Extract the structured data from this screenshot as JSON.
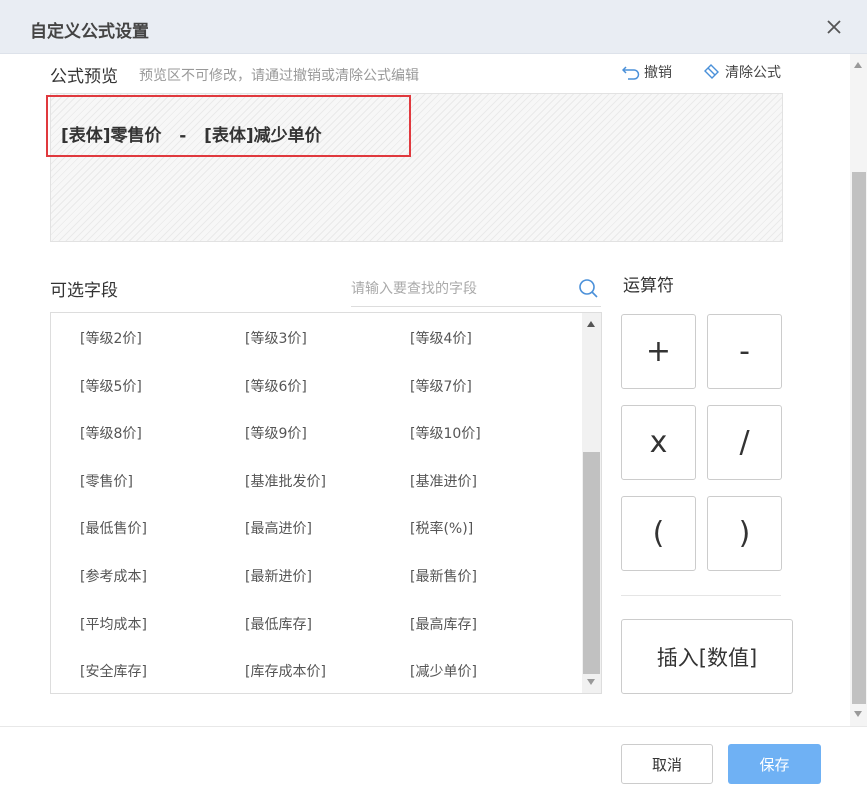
{
  "dialog": {
    "title": "自定义公式设置"
  },
  "preview": {
    "label": "公式预览",
    "hint": "预览区不可修改，请通过撤销或清除公式编辑",
    "undo_label": "撤销",
    "clear_label": "清除公式",
    "formula": "[表体]零售价   -   [表体]减少单价"
  },
  "fields": {
    "label": "可选字段",
    "search_placeholder": "请输入要查找的字段",
    "rows": [
      [
        "[等级2价]",
        "[等级3价]",
        "[等级4价]"
      ],
      [
        "[等级5价]",
        "[等级6价]",
        "[等级7价]"
      ],
      [
        "[等级8价]",
        "[等级9价]",
        "[等级10价]"
      ],
      [
        "[零售价]",
        "[基准批发价]",
        "[基准进价]"
      ],
      [
        "[最低售价]",
        "[最高进价]",
        "[税率(%)]"
      ],
      [
        "[参考成本]",
        "[最新进价]",
        "[最新售价]"
      ],
      [
        "[平均成本]",
        "[最低库存]",
        "[最高库存]"
      ],
      [
        "[安全库存]",
        "[库存成本价]",
        "[减少单价]"
      ]
    ]
  },
  "operators": {
    "label": "运算符",
    "plus": "+",
    "minus": "-",
    "multiply": "x",
    "divide": "/",
    "lparen": "(",
    "rparen": ")",
    "insert_label": "插入[数值]"
  },
  "footer": {
    "cancel_label": "取消",
    "save_label": "保存"
  },
  "colors": {
    "highlight_border": "#e0393e",
    "primary": "#6fb1f4",
    "icon": "#4a90d9"
  }
}
